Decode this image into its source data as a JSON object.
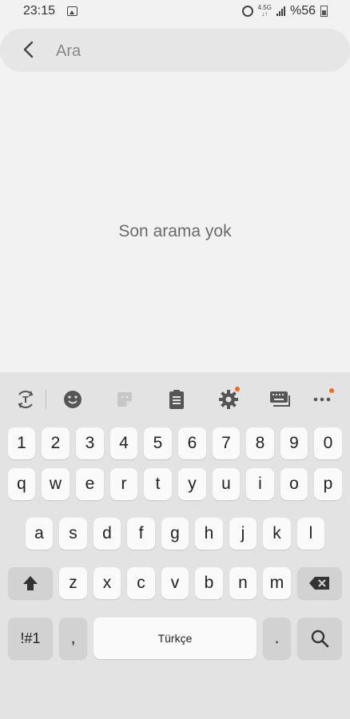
{
  "status": {
    "time": "23:15",
    "network": "4.5G",
    "battery": "%56"
  },
  "search": {
    "placeholder": "Ara"
  },
  "main": {
    "empty_text": "Son arama yok"
  },
  "keyboard": {
    "numbers": [
      "1",
      "2",
      "3",
      "4",
      "5",
      "6",
      "7",
      "8",
      "9",
      "0"
    ],
    "row1": [
      "q",
      "w",
      "e",
      "r",
      "t",
      "y",
      "u",
      "i",
      "o",
      "p"
    ],
    "row2": [
      "a",
      "s",
      "d",
      "f",
      "g",
      "h",
      "j",
      "k",
      "l"
    ],
    "row3": [
      "z",
      "x",
      "c",
      "v",
      "b",
      "n",
      "m"
    ],
    "symbols_label": "!#1",
    "comma": ",",
    "space_label": "Türkçe",
    "period": "."
  }
}
